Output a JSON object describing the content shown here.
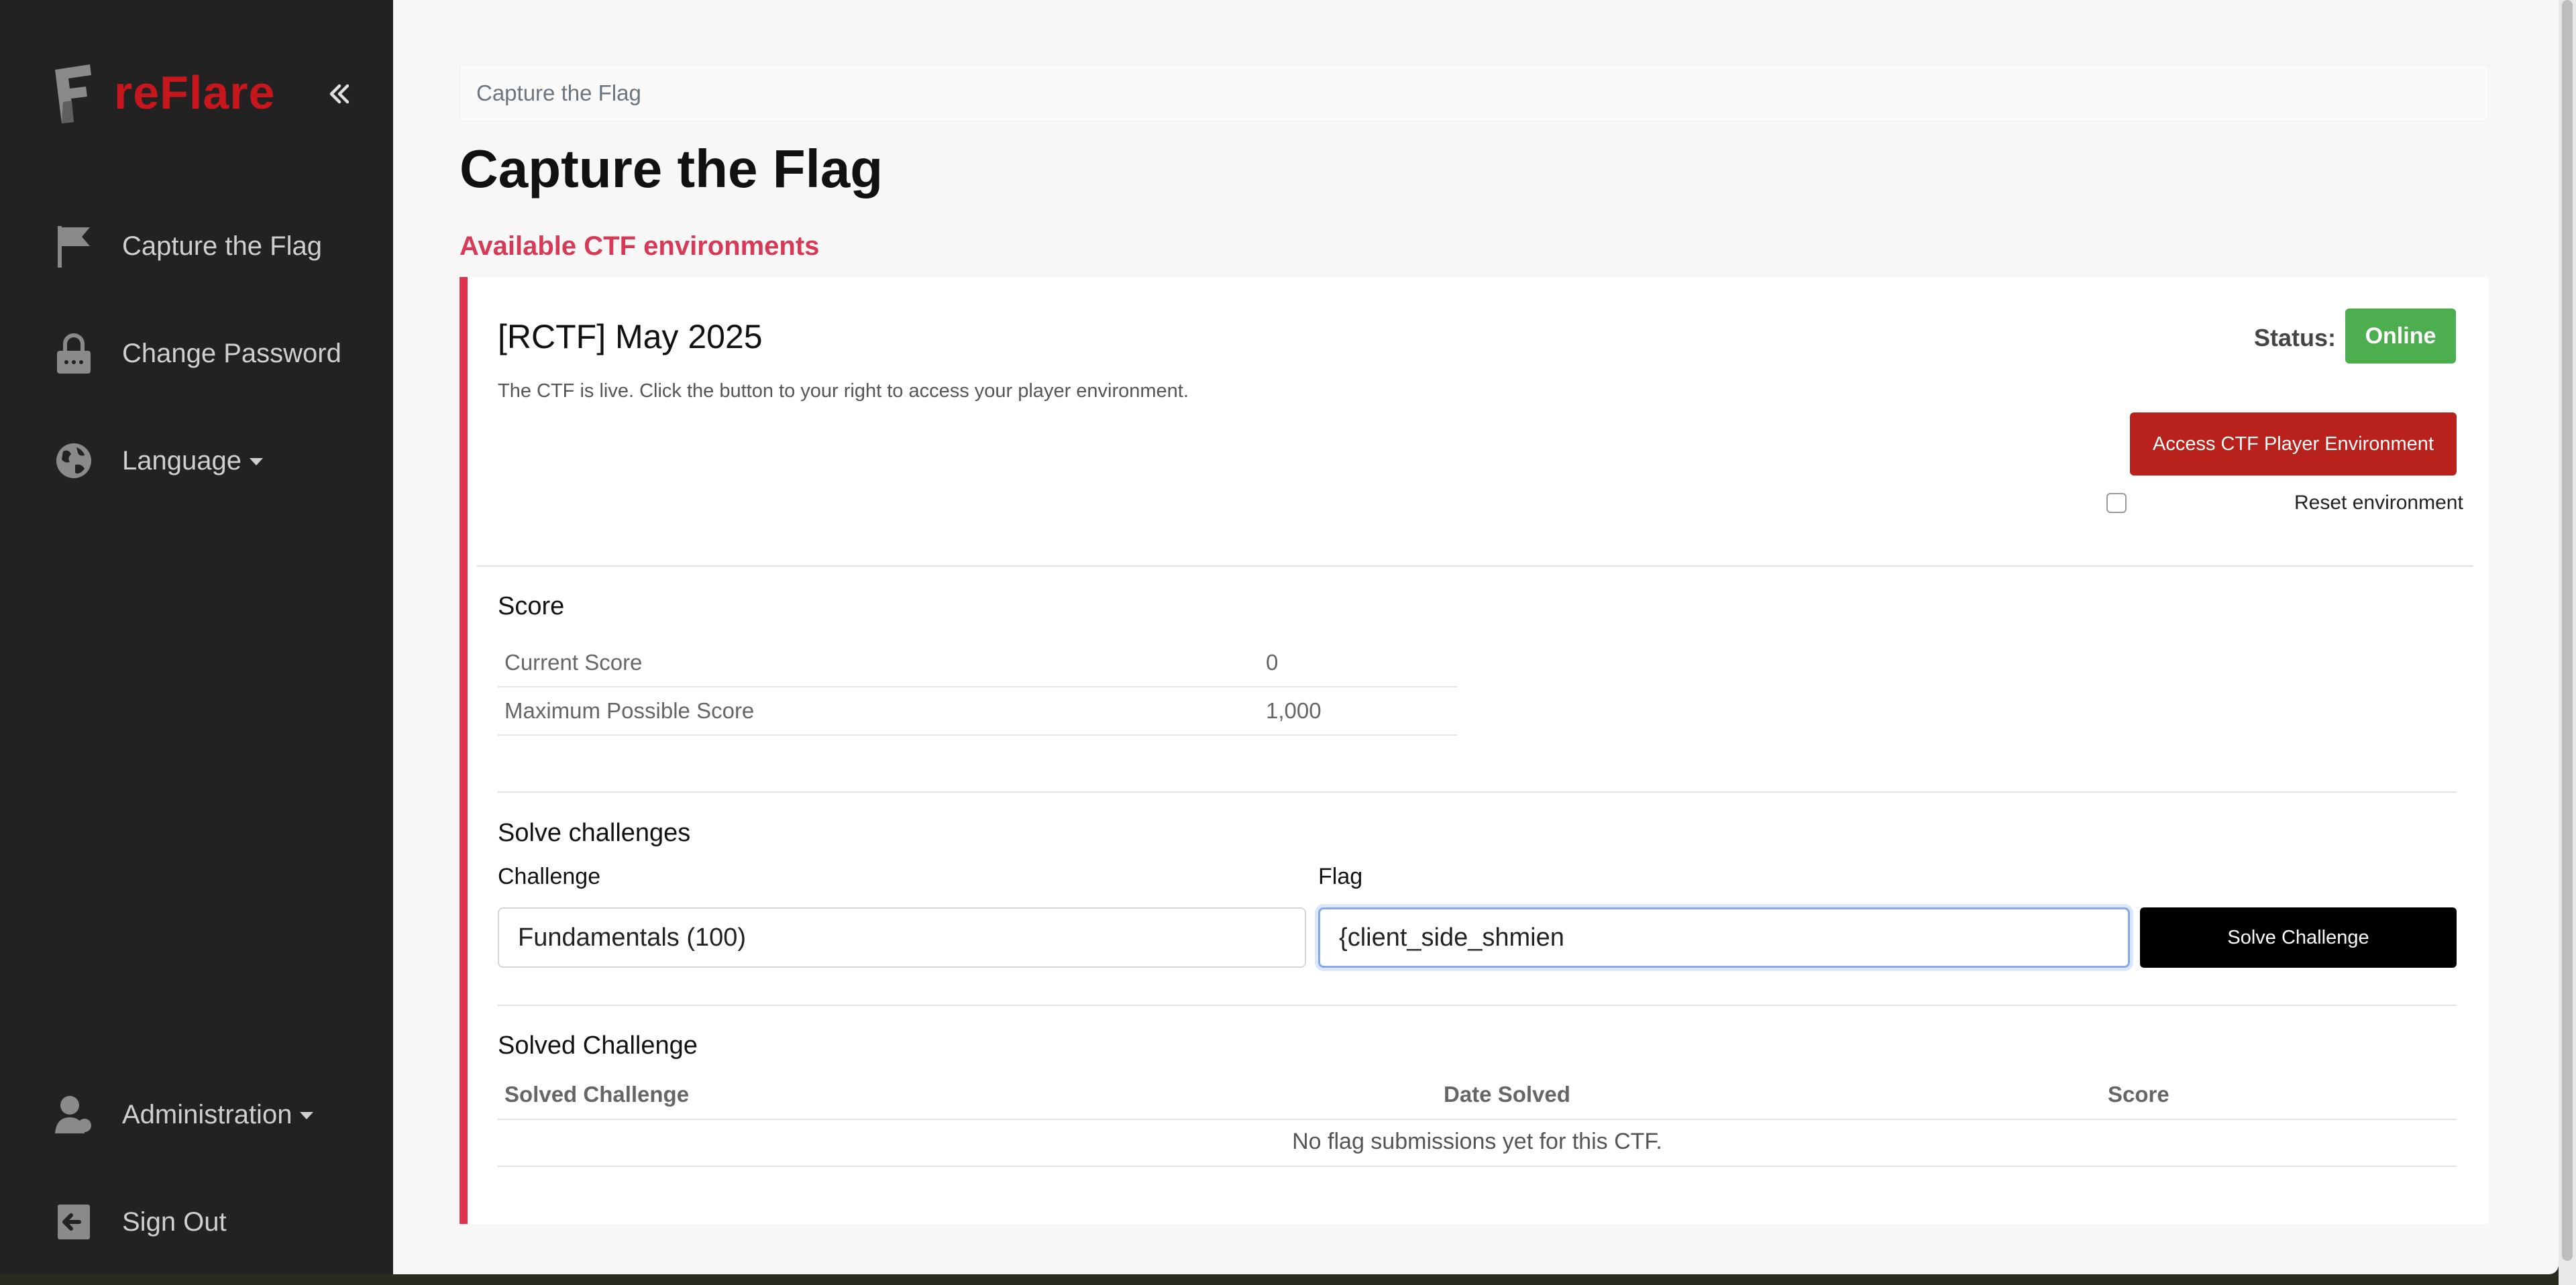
{
  "sidebar": {
    "logo_text": "reFlare",
    "items": [
      {
        "label": "Capture the Flag",
        "icon": "flag-icon"
      },
      {
        "label": "Change Password",
        "icon": "lock-icon"
      },
      {
        "label": "Language",
        "icon": "globe-icon"
      },
      {
        "label": "Administration",
        "icon": "user-icon"
      },
      {
        "label": "Sign Out",
        "icon": "sign-out-icon"
      }
    ]
  },
  "breadcrumb": "Capture the Flag",
  "page_title": "Capture the Flag",
  "section_heading": "Available CTF environments",
  "environment": {
    "title": "[RCTF] May 2025",
    "description": "The CTF is live. Click the button to your right to access your player environment.",
    "status_label": "Status:",
    "status": "Online",
    "access_button": "Access CTF Player Environment",
    "reset_label": "Reset environment"
  },
  "score": {
    "heading": "Score",
    "rows": [
      {
        "label": "Current Score",
        "value": "0"
      },
      {
        "label": "Maximum Possible Score",
        "value": "1,000"
      }
    ]
  },
  "solve": {
    "heading": "Solve challenges",
    "challenge_label": "Challenge",
    "challenge_value": "Fundamentals (100)",
    "flag_label": "Flag",
    "flag_value": "{client_side_shmien",
    "button": "Solve Challenge"
  },
  "solved": {
    "heading": "Solved Challenge",
    "columns": [
      "Solved Challenge",
      "Date Solved",
      "Score"
    ],
    "empty_message": "No flag submissions yet for this CTF."
  },
  "colors": {
    "accent": "#e0314f",
    "status_online": "#4cae4f",
    "access_button": "#b8211c",
    "sidebar": "#222222"
  }
}
